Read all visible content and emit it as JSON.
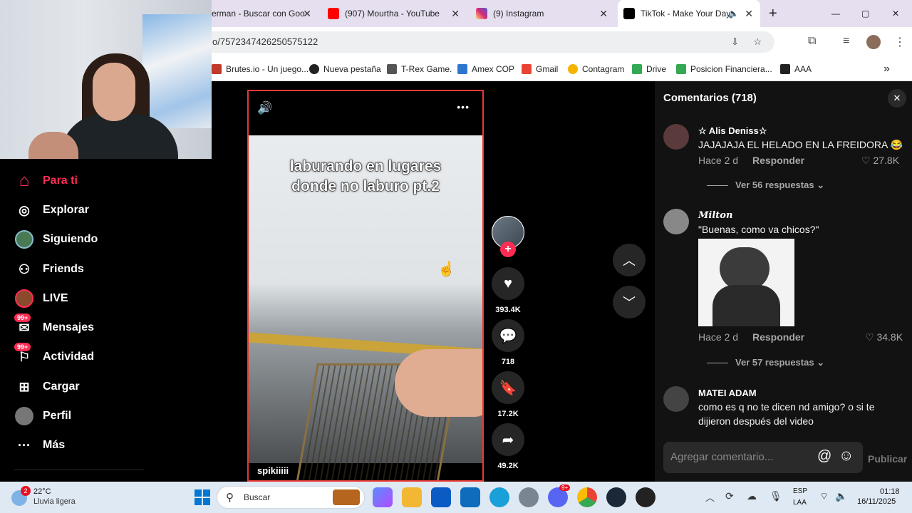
{
  "browser": {
    "tabs": [
      {
        "title": "erman - Buscar con Goo",
        "icon_color": "#4285f4"
      },
      {
        "title": "(907) Mourtha - YouTube",
        "icon_color": "#ff0000"
      },
      {
        "title": "(9) Instagram",
        "icon_color": "#d62976"
      },
      {
        "title": "TikTok - Make Your Day",
        "icon_color": "#000000"
      }
    ],
    "close_glyph": "✕",
    "new_tab_glyph": "+",
    "url": "o/7572347426250575122",
    "window_controls": {
      "minimize": "—",
      "maximize": "▢",
      "close": "✕"
    },
    "bookmarks": [
      "Brutes.io - Un juego...",
      "Nueva pestaña",
      "T-Rex Game.",
      "Amex COP",
      "Gmail",
      "Contagram",
      "Drive",
      "Posicion Financiera...",
      "AAA"
    ],
    "bookmarks_overflow": "»"
  },
  "sidebar": {
    "items": [
      {
        "label": "Para ti",
        "icon": "home-icon",
        "glyph": "⌂"
      },
      {
        "label": "Explorar",
        "icon": "compass-icon",
        "glyph": "◎"
      },
      {
        "label": "Siguiendo",
        "icon": "following-avatar-icon",
        "glyph": "●"
      },
      {
        "label": "Friends",
        "icon": "friends-icon",
        "glyph": "👥"
      },
      {
        "label": "LIVE",
        "icon": "live-icon",
        "glyph": "●"
      },
      {
        "label": "Mensajes",
        "icon": "messages-icon",
        "glyph": "✉",
        "badge": "99+"
      },
      {
        "label": "Actividad",
        "icon": "activity-icon",
        "glyph": "⚐",
        "badge": "99+"
      },
      {
        "label": "Cargar",
        "icon": "upload-icon",
        "glyph": "⊞"
      },
      {
        "label": "Perfil",
        "icon": "profile-icon",
        "glyph": "●"
      },
      {
        "label": "Más",
        "icon": "more-icon",
        "glyph": "···"
      }
    ],
    "active_color": "#fe2c55"
  },
  "video": {
    "caption_line1": "laburando en lugares",
    "caption_line2": "donde no laburo pt.2",
    "author": "spikiiiii",
    "volume_glyph": "🔊",
    "menu_glyph": "•••"
  },
  "actions": {
    "follow_glyph": "+",
    "likes": "393.4K",
    "comments": "718",
    "saves": "17.2K",
    "shares": "49.2K"
  },
  "comments_panel": {
    "title": "Comentarios (718)",
    "close_glyph": "✕",
    "comments": [
      {
        "author": "☆ Alis Deniss☆",
        "text": "JAJAJAJA EL HELADO EN LA FREIDORA 😂",
        "time": "Hace 2 d",
        "reply": "Responder",
        "likes": "27.8K",
        "replies": "Ver 56 respuestas"
      },
      {
        "author": "𝑴𝒊𝒍𝒕𝒐𝒏",
        "text": "\"Buenas, como va chicos?\"",
        "time": "Hace 2 d",
        "reply": "Responder",
        "likes": "34.8K",
        "replies": "Ver 57 respuestas"
      },
      {
        "author": "MATEI ADAM",
        "text": "como es q no te dicen nd amigo? o si te dijieron después del video"
      }
    ],
    "input_placeholder": "Agregar comentario...",
    "mention_glyph": "@",
    "emoji_glyph": "☺",
    "post_label": "Publicar",
    "heart_glyph": "♡",
    "chevron_glyph": "⌄"
  },
  "taskbar": {
    "weather_temp": "22°C",
    "weather_desc": "Lluvia ligera",
    "weather_badge": "2",
    "search_placeholder": "Buscar",
    "lang_top": "ESP",
    "lang_bottom": "LAA",
    "time": "01:18",
    "date": "16/11/2025",
    "discord_badge": "9+"
  }
}
